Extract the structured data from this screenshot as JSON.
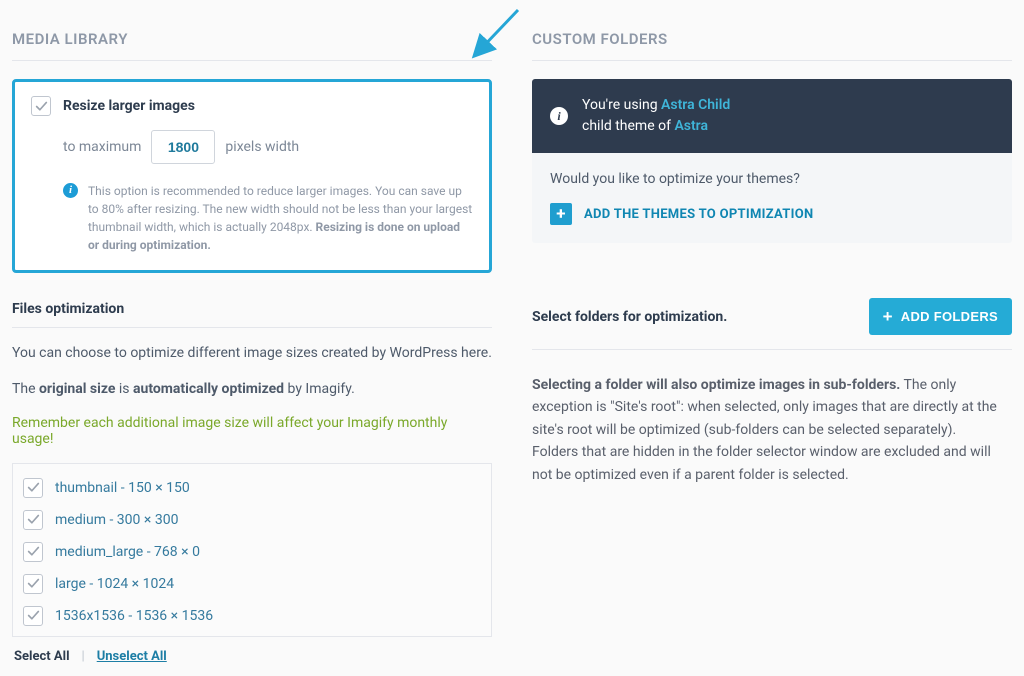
{
  "left": {
    "heading": "MEDIA LIBRARY",
    "resize": {
      "checkbox_label": "Resize larger images",
      "prefix": "to maximum",
      "width_value": "1800",
      "suffix": "pixels width",
      "info_pre": "This option is recommended to reduce larger images. You can save up to 80% after resizing. The new width should not be less than your largest thumbnail width, which is actually 2048px. ",
      "info_bold": "Resizing is done on upload or during optimization."
    },
    "files": {
      "title": "Files optimization",
      "desc": "You can choose to optimize different image sizes created by WordPress here.",
      "line2_a": "The ",
      "line2_b": "original size",
      "line2_c": " is ",
      "line2_d": "automatically optimized",
      "line2_e": " by Imagify.",
      "warn": "Remember each additional image size will affect your Imagify monthly usage!",
      "sizes": [
        "thumbnail - 150 × 150",
        "medium - 300 × 300",
        "medium_large - 768 × 0",
        "large - 1024 × 1024",
        "1536x1536 - 1536 × 1536"
      ],
      "select_all": "Select All",
      "unselect_all": "Unselect All"
    }
  },
  "right": {
    "heading": "CUSTOM FOLDERS",
    "banner": {
      "line1_a": "You're using ",
      "line1_link": "Astra Child",
      "line2_a": "child theme of ",
      "line2_link": "Astra"
    },
    "theme_q": "Would you like to optimize your themes?",
    "add_themes": "ADD THE THEMES TO OPTIMIZATION",
    "folders_title": "Select folders for optimization.",
    "add_folders": "ADD FOLDERS",
    "desc_bold": "Selecting a folder will also optimize images in sub-folders.",
    "desc_rest": " The only exception is \"Site's root\": when selected, only images that are directly at the site's root will be optimized (sub-folders can be selected separately).",
    "desc_p2": "Folders that are hidden in the folder selector window are excluded and will not be optimized even if a parent folder is selected."
  }
}
